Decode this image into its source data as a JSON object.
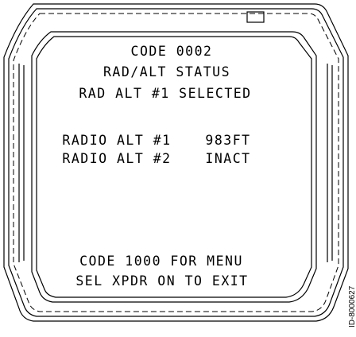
{
  "screen": {
    "line1": "CODE 0002",
    "line2": "RAD/ALT STATUS",
    "line3": "RAD ALT #1 SELECTED",
    "radio1_label": "RADIO ALT #1",
    "radio1_value": "983FT",
    "radio2_label": "RADIO ALT #2",
    "radio2_value": "INACT",
    "footer1": "CODE 1000 FOR MENU",
    "footer2": "SEL XPDR ON TO EXIT"
  },
  "figure_id": "ID-8000627"
}
